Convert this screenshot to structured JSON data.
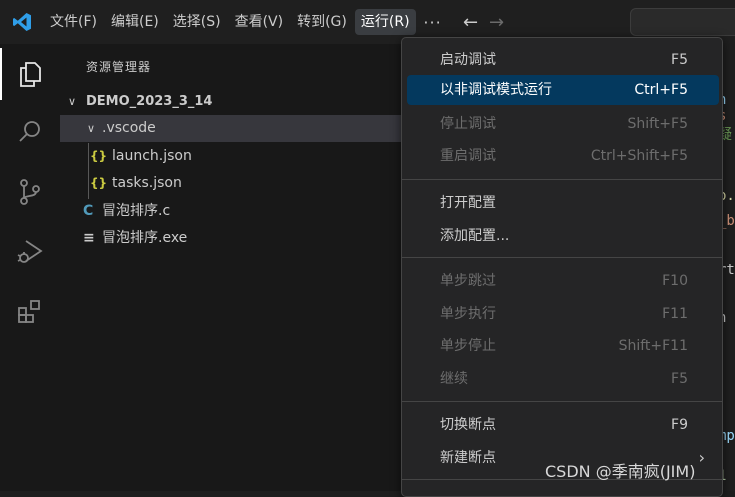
{
  "menubar": {
    "items": [
      {
        "label": "文件(F)"
      },
      {
        "label": "编辑(E)"
      },
      {
        "label": "选择(S)"
      },
      {
        "label": "查看(V)"
      },
      {
        "label": "转到(G)"
      },
      {
        "label": "运行(R)"
      }
    ],
    "more_label": "···",
    "active_menu": "运行(R)"
  },
  "icons": {
    "logo": "vscode-logo-icon",
    "back": "arrow-left-icon",
    "forward": "arrow-right-icon",
    "activity": [
      "explorer-icon",
      "search-icon",
      "source-control-icon",
      "run-debug-icon",
      "extensions-icon"
    ]
  },
  "explorer": {
    "title": "资源管理器",
    "root": "DEMO_2023_3_14",
    "folder": ".vscode",
    "files_in_folder": [
      {
        "icon": "{}",
        "name": "launch.json"
      },
      {
        "icon": "{}",
        "name": "tasks.json"
      }
    ],
    "root_files": [
      {
        "icon": "C",
        "name": "冒泡排序.c"
      },
      {
        "icon": "≡",
        "name": "冒泡排序.exe"
      }
    ]
  },
  "run_menu": {
    "groups": [
      [
        {
          "label": "启动调试",
          "key": "F5",
          "state": "normal"
        },
        {
          "label": "以非调试模式运行",
          "key": "Ctrl+F5",
          "state": "highlighted"
        },
        {
          "label": "停止调试",
          "key": "Shift+F5",
          "state": "disabled"
        },
        {
          "label": "重启调试",
          "key": "Ctrl+Shift+F5",
          "state": "disabled"
        }
      ],
      [
        {
          "label": "打开配置",
          "key": "",
          "state": "normal"
        },
        {
          "label": "添加配置...",
          "key": "",
          "state": "normal"
        }
      ],
      [
        {
          "label": "单步跳过",
          "key": "F10",
          "state": "disabled"
        },
        {
          "label": "单步执行",
          "key": "F11",
          "state": "disabled"
        },
        {
          "label": "单步停止",
          "key": "Shift+F11",
          "state": "disabled"
        },
        {
          "label": "继续",
          "key": "F5",
          "state": "disabled"
        }
      ],
      [
        {
          "label": "切换断点",
          "key": "F9",
          "state": "normal"
        },
        {
          "label": "新建断点",
          "key": "",
          "state": "normal",
          "submenu": true
        }
      ]
    ]
  },
  "editor_peek": [
    "h",
    "s",
    "疑",
    "p.",
    "_b",
    "rt",
    "h",
    "mp",
    "1"
  ],
  "watermark": "CSDN @季南疯(JIM)",
  "colors": {
    "highlight": "#04395e",
    "disabled_text": "#6d6d6d",
    "json_icon": "#cbcb41",
    "c_icon": "#519aba"
  }
}
